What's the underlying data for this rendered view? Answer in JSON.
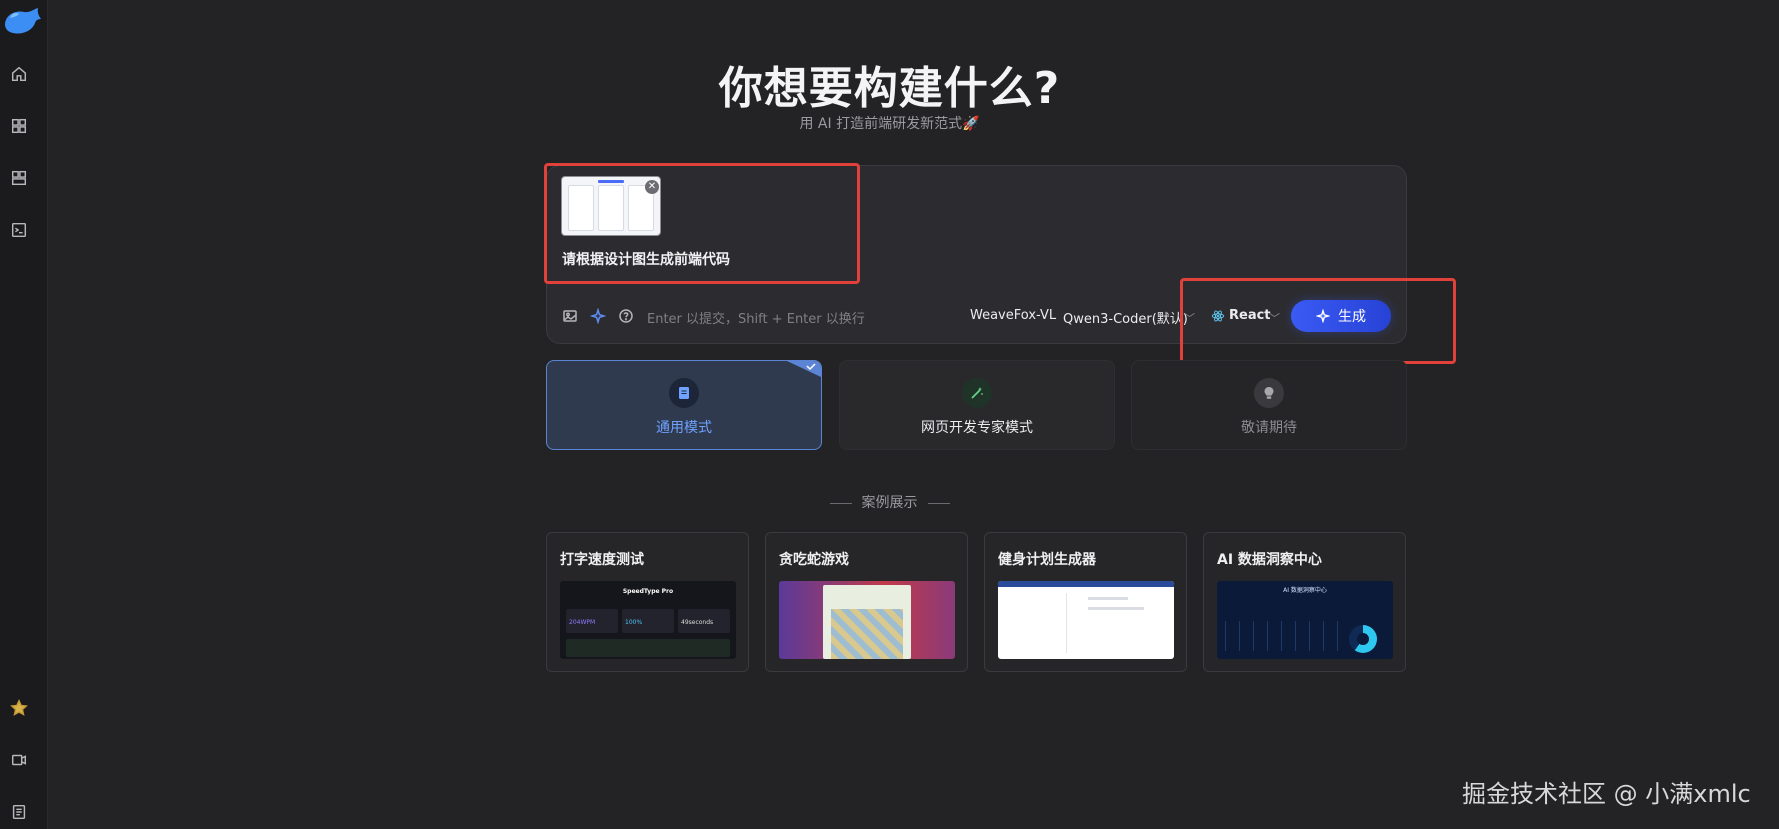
{
  "colors": {
    "background": "#232325",
    "accent": "#3a5af4",
    "highlight": "#e0413a"
  },
  "sidebar": {
    "icons": [
      "home-icon",
      "grid-icon",
      "layout-icon",
      "terminal-icon",
      "star-icon",
      "video-icon",
      "notes-icon"
    ]
  },
  "hero": {
    "title": "你想要构建什么?",
    "subtitle": "用 AI 打造前端研发新范式🚀"
  },
  "prompt": {
    "attachment_close": "✕",
    "text": "请根据设计图生成前端代码",
    "placeholder": "Enter 以提交，Shift + Enter 以换行",
    "model_vision": "WeaveFox-VL",
    "model_coder": "Qwen3-Coder(默认)",
    "framework": "React",
    "generate_label": "生成"
  },
  "modes": [
    {
      "label": "通用模式",
      "active": true,
      "check": "✓"
    },
    {
      "label": "网页开发专家模式",
      "active": false
    },
    {
      "label": "敬请期待",
      "active": false
    }
  ],
  "cases": {
    "heading": "案例展示",
    "items": [
      {
        "title": "打字速度测试",
        "preview_heading": "SpeedType Pro",
        "stats": [
          "204WPM",
          "100%",
          "49seconds"
        ]
      },
      {
        "title": "贪吃蛇游戏"
      },
      {
        "title": "健身计划生成器"
      },
      {
        "title": "AI 数据洞察中心",
        "preview_heading": "AI 数据洞察中心"
      }
    ]
  },
  "watermark": "掘金技术社区 @ 小满xmlc"
}
